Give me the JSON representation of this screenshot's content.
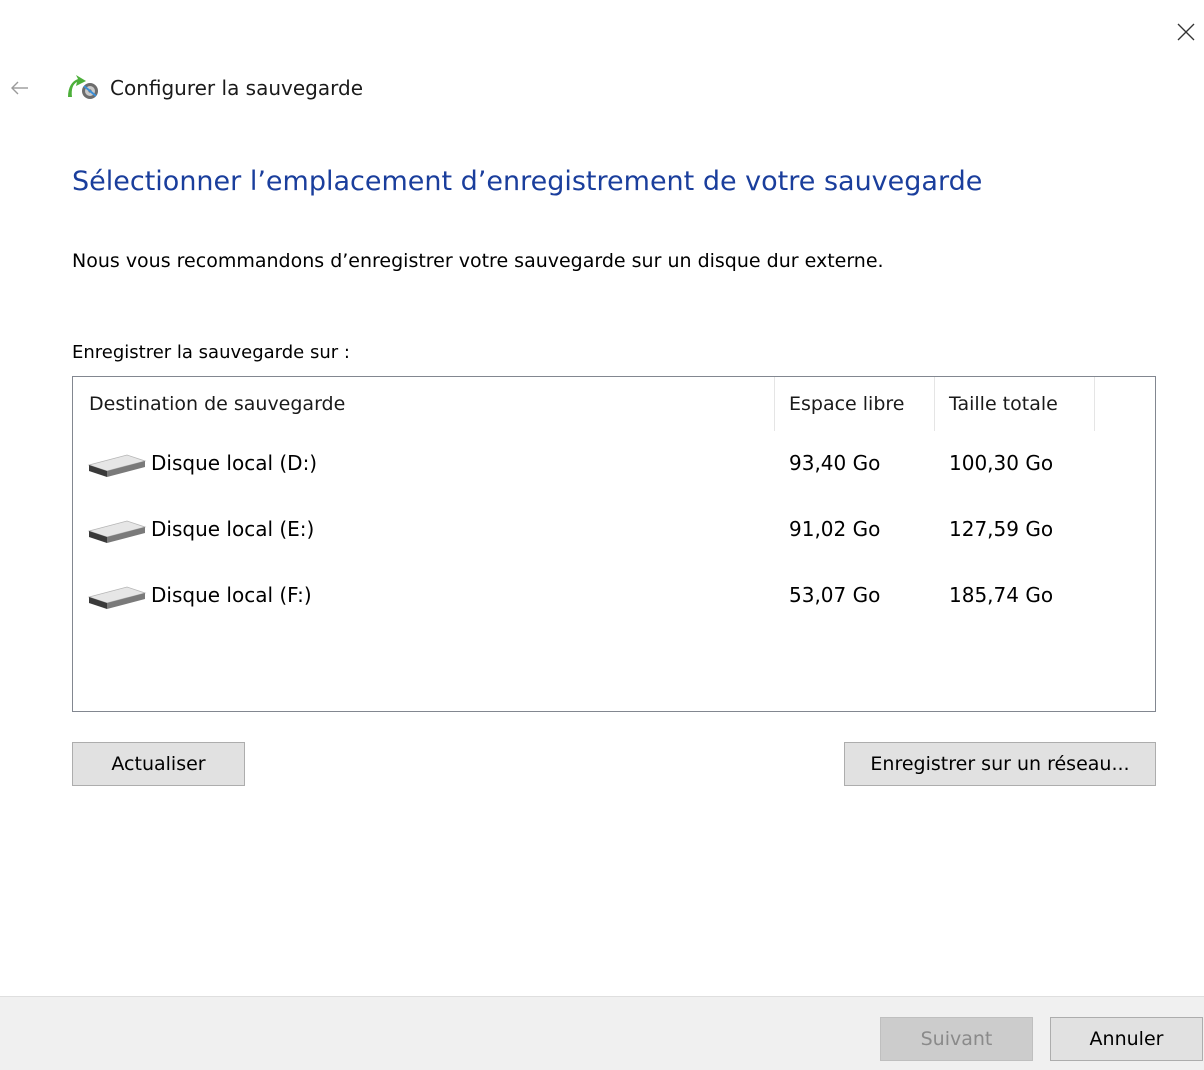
{
  "window": {
    "title": "Configurer la sauvegarde"
  },
  "page": {
    "heading": "Sélectionner l’emplacement d’enregistrement de votre sauvegarde",
    "intro": "Nous vous recommandons d’enregistrer votre sauvegarde sur un disque dur externe.",
    "list_label": "Enregistrer la sauvegarde sur :"
  },
  "table": {
    "columns": [
      "Destination de sauvegarde",
      "Espace libre",
      "Taille totale"
    ],
    "rows": [
      {
        "name": "Disque local (D:)",
        "free": "93,40 Go",
        "total": "100,30 Go",
        "icon": "drive-icon"
      },
      {
        "name": "Disque local (E:)",
        "free": "91,02 Go",
        "total": "127,59 Go",
        "icon": "drive-icon"
      },
      {
        "name": "Disque local (F:)",
        "free": "53,07 Go",
        "total": "185,74 Go",
        "icon": "drive-icon"
      }
    ]
  },
  "buttons": {
    "refresh": "Actualiser",
    "network": "Enregistrer sur un réseau...",
    "next": "Suivant",
    "cancel": "Annuler"
  },
  "state": {
    "next_enabled": false
  },
  "colors": {
    "heading": "#1a3e9c",
    "footer_bg": "#f0f0f0",
    "button_bg": "#e1e1e1",
    "disabled_text": "#8a8a8a"
  },
  "icons": {
    "close": "close-icon",
    "back": "back-arrow-icon",
    "app": "backup-app-icon",
    "drive": "drive-icon"
  }
}
